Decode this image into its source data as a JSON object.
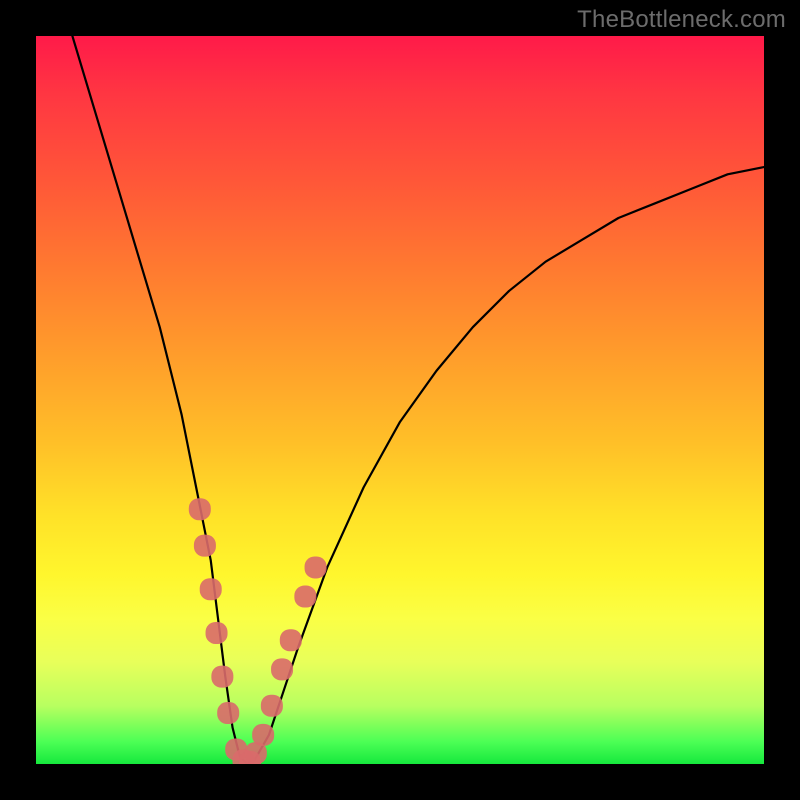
{
  "watermark_text": "TheBottleneck.com",
  "chart_data": {
    "type": "line",
    "title": "",
    "xlabel": "",
    "ylabel": "",
    "xlim": [
      0,
      100
    ],
    "ylim": [
      0,
      100
    ],
    "series": [
      {
        "name": "bottleneck-curve",
        "x": [
          5,
          8,
          11,
          14,
          17,
          20,
          22,
          24,
          25,
          26,
          27,
          28,
          29,
          30,
          32,
          34,
          36,
          40,
          45,
          50,
          55,
          60,
          65,
          70,
          75,
          80,
          85,
          90,
          95,
          100
        ],
        "y": [
          100,
          90,
          80,
          70,
          60,
          48,
          38,
          28,
          20,
          12,
          5,
          1,
          0,
          0.5,
          4,
          10,
          16,
          27,
          38,
          47,
          54,
          60,
          65,
          69,
          72,
          75,
          77,
          79,
          81,
          82
        ]
      }
    ],
    "marker_points": {
      "name": "highlighted-range",
      "color": "#d96a6a",
      "points": [
        {
          "x": 22.5,
          "y": 35
        },
        {
          "x": 23.2,
          "y": 30
        },
        {
          "x": 24.0,
          "y": 24
        },
        {
          "x": 24.8,
          "y": 18
        },
        {
          "x": 25.6,
          "y": 12
        },
        {
          "x": 26.4,
          "y": 7
        },
        {
          "x": 27.5,
          "y": 2
        },
        {
          "x": 28.5,
          "y": 0.5
        },
        {
          "x": 29.4,
          "y": 0.3
        },
        {
          "x": 30.2,
          "y": 1.5
        },
        {
          "x": 31.2,
          "y": 4
        },
        {
          "x": 32.4,
          "y": 8
        },
        {
          "x": 33.8,
          "y": 13
        },
        {
          "x": 35.0,
          "y": 17
        },
        {
          "x": 37.0,
          "y": 23
        },
        {
          "x": 38.4,
          "y": 27
        }
      ]
    }
  }
}
